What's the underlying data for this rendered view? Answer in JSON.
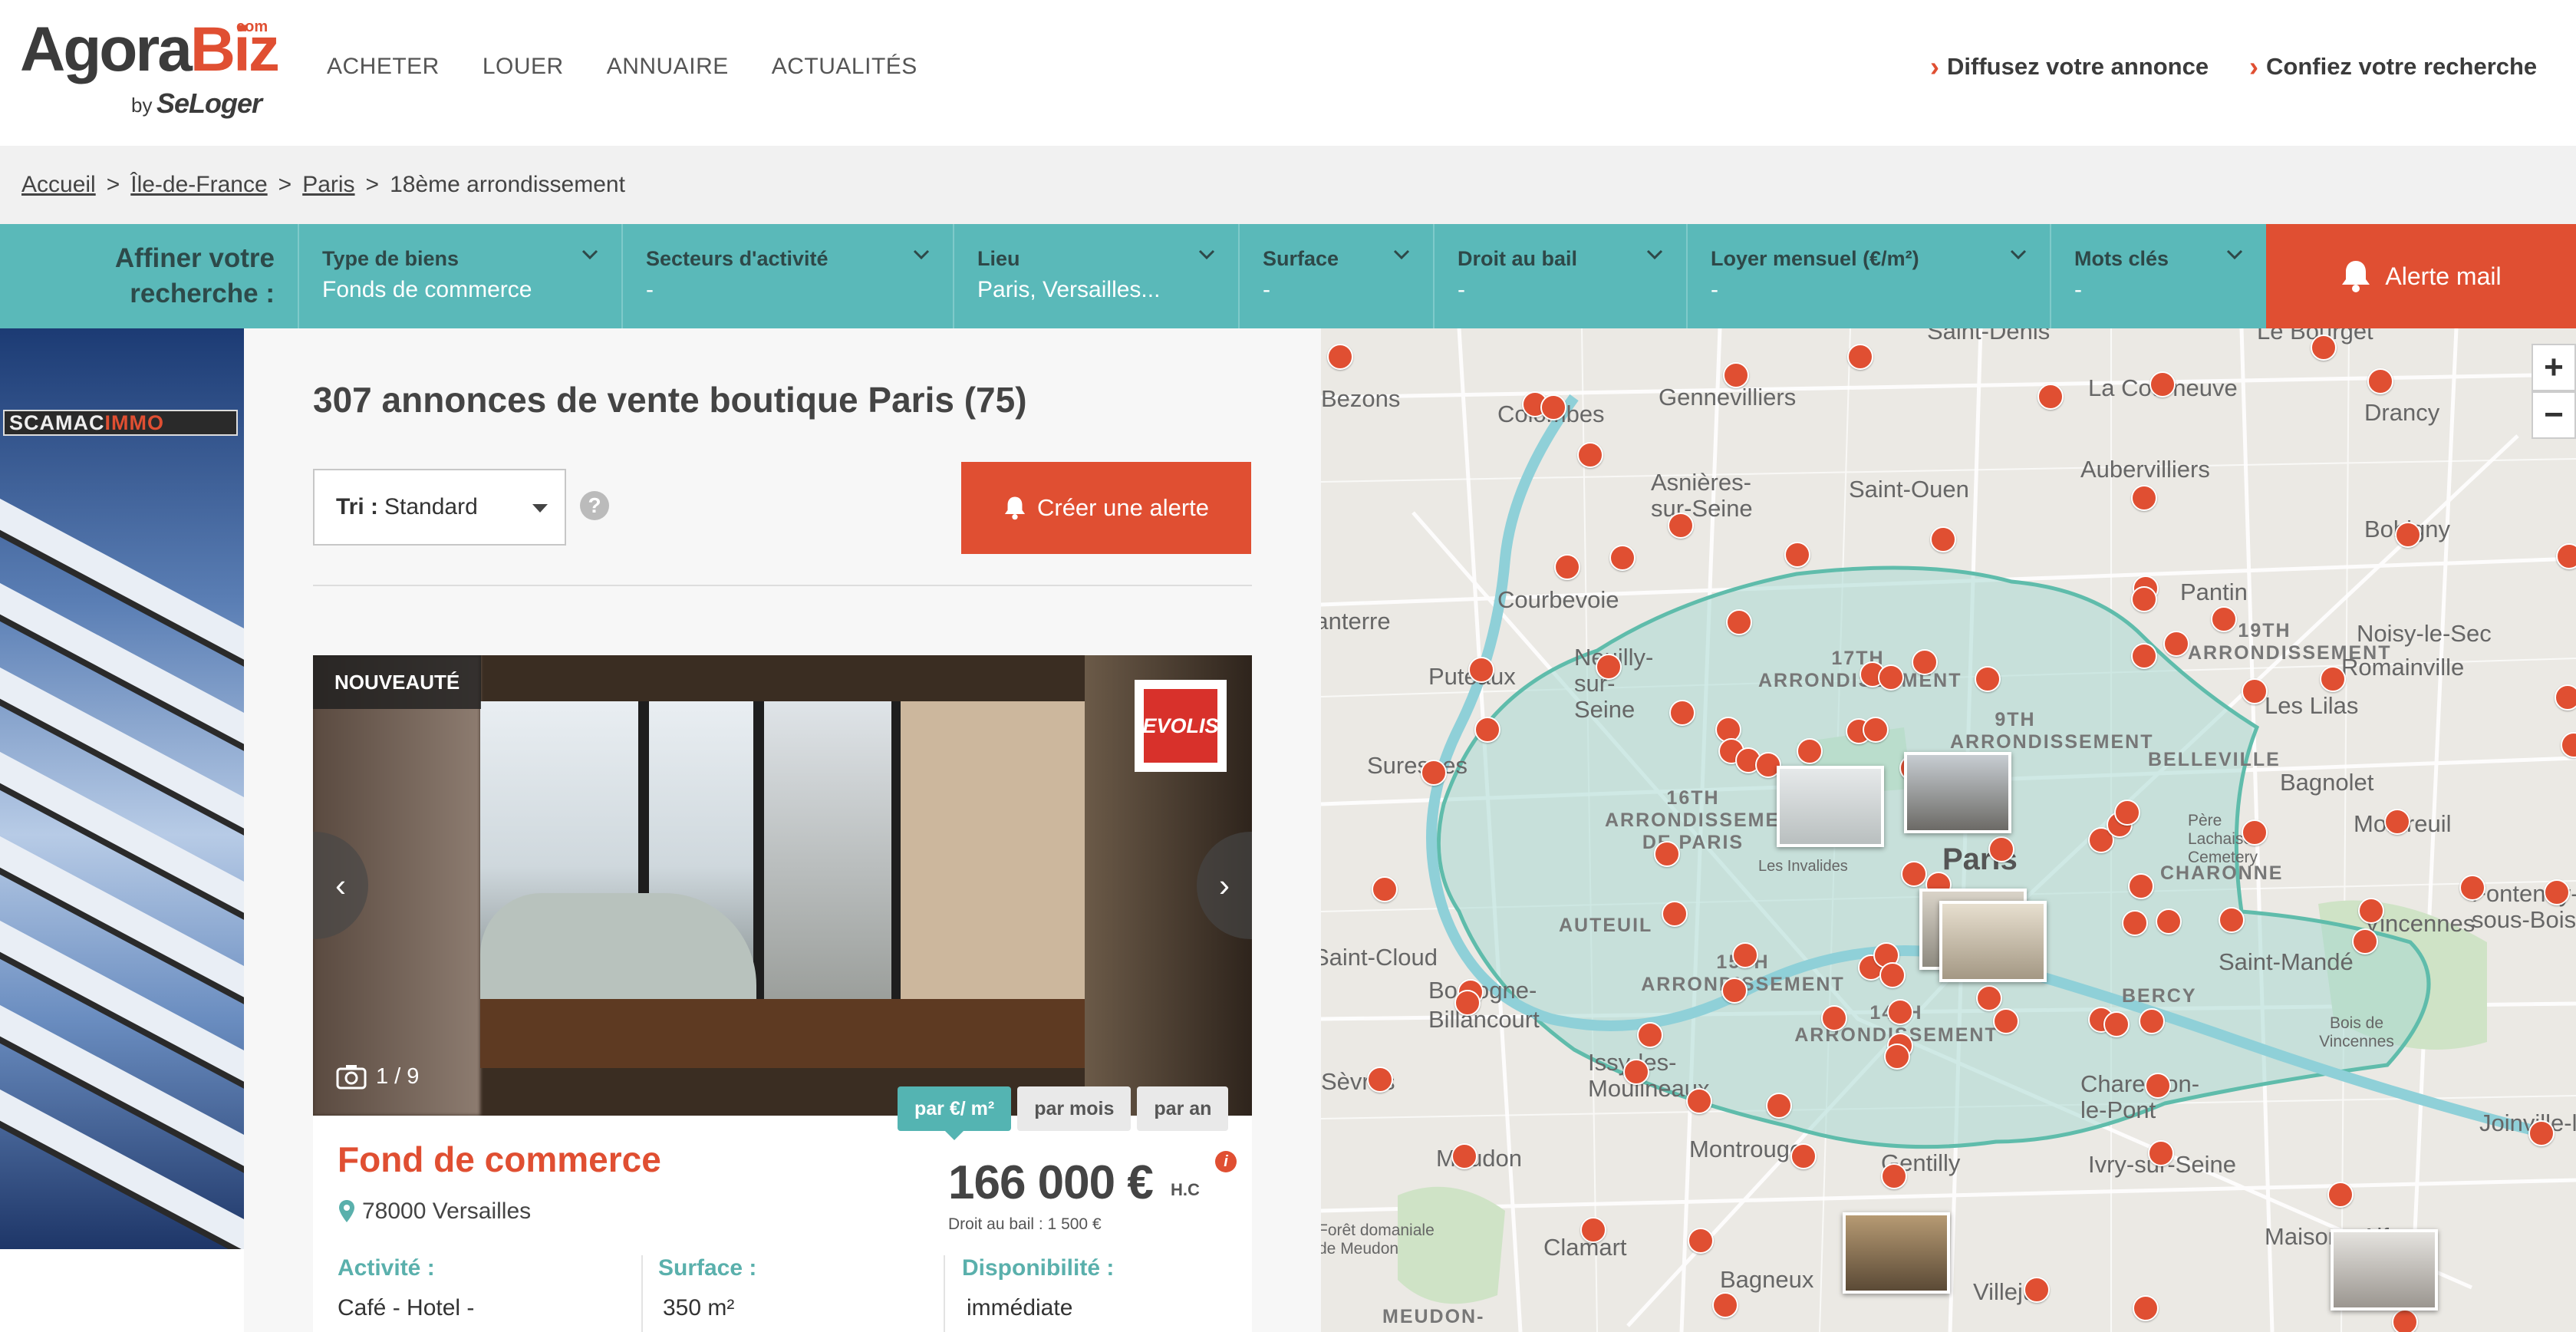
{
  "header": {
    "logo": {
      "agora": "Agora",
      "biz": "Biz",
      "com": "com",
      "by": "by",
      "seloger": "SeLoger"
    },
    "nav": [
      "ACHETER",
      "LOUER",
      "ANNUAIRE",
      "ACTUALITÉS"
    ],
    "links": {
      "publish": "Diffusez votre annonce",
      "entrust": "Confiez votre recherche"
    }
  },
  "breadcrumb": {
    "items": [
      "Accueil",
      "Île-de-France",
      "Paris"
    ],
    "current": "18ème arrondissement",
    "separator": ">"
  },
  "filters": {
    "refine_line1": "Affiner votre",
    "refine_line2": "recherche :",
    "items": [
      {
        "label": "Type de biens",
        "value": "Fonds de commerce"
      },
      {
        "label": "Secteurs d'activité",
        "value": "-"
      },
      {
        "label": "Lieu",
        "value": "Paris, Versailles..."
      },
      {
        "label": "Surface",
        "value": "-"
      },
      {
        "label": "Droit au bail",
        "value": "-"
      },
      {
        "label": "Loyer mensuel (€/m²)",
        "value": "-"
      },
      {
        "label": "Mots clés",
        "value": "-"
      }
    ],
    "alert_mail": "Alerte mail"
  },
  "ad": {
    "brand_a": "SCAMAC",
    "brand_b": "IMMO"
  },
  "listing": {
    "results_title": "307 annonces de vente boutique Paris (75)",
    "sort": {
      "label": "Tri :",
      "value": "Standard"
    },
    "help": "?",
    "create_alert": "Créer une alerte",
    "card": {
      "badge": "NOUVEAUTÉ",
      "agency": "EVOLIS",
      "photo_counter": "1 / 9",
      "price_tabs": [
        "par €/ m²",
        "par mois",
        "par an"
      ],
      "title": "Fond de commerce",
      "location": "78000 Versailles",
      "price": "166 000 €",
      "price_suffix": "H.C",
      "info": "i",
      "droit_bail": "Droit au bail : 1 500 €",
      "attributes": [
        {
          "label": "Activité :",
          "value": "Café - Hotel -"
        },
        {
          "label": "Surface :",
          "value": "350 m²"
        },
        {
          "label": "Disponibilité :",
          "value": "immédiate"
        }
      ]
    }
  },
  "map": {
    "zoom_in": "+",
    "zoom_out": "−",
    "places": [
      "Saint-Denis",
      "Le Bourget",
      "Bezons",
      "Gennevilliers",
      "La Courneuve",
      "Drancy",
      "Colombes",
      "Aubervilliers",
      "Asnières-sur-Seine",
      "Saint-Ouen",
      "Bobigny",
      "Courbevoie",
      "Pantin",
      "Noisy-le-Sec",
      "Nanterre",
      "Neuilly-sur-Seine",
      "Romainville",
      "Puteaux",
      "Les Lilas",
      "Suresnes",
      "Bagnolet",
      "Montreuil",
      "Saint-Cloud",
      "Boulogne-Billancourt",
      "Vincennes",
      "Fontenay-sous-Bois",
      "Saint-Mandé",
      "Sèvres",
      "Issy-les-Moulineaux",
      "Charenton-le-Pont",
      "Joinville-le-Pont",
      "Meudon",
      "Montrouge",
      "Gentilly",
      "Ivry-sur-Seine",
      "Clamart",
      "Bagneux",
      "Villejuif",
      "Maisons-Alfort",
      "Paris",
      "Les Invalides",
      "Père Lachaise Cemetery",
      "Bois de Vincennes",
      "Forêt domaniale de Meudon"
    ],
    "districts": [
      "17TH ARRONDISSEMENT",
      "9TH ARRONDISSEMENT",
      "19TH ARRONDISSEMENT",
      "BELLEVILLE",
      "16TH ARRONDISSEMENT DE PARIS",
      "CHARONNE",
      "AUTEUIL",
      "15TH ARRONDISSEMENT",
      "14TH ARRONDISSEMENT",
      "BERCY",
      "MEUDON-"
    ]
  }
}
